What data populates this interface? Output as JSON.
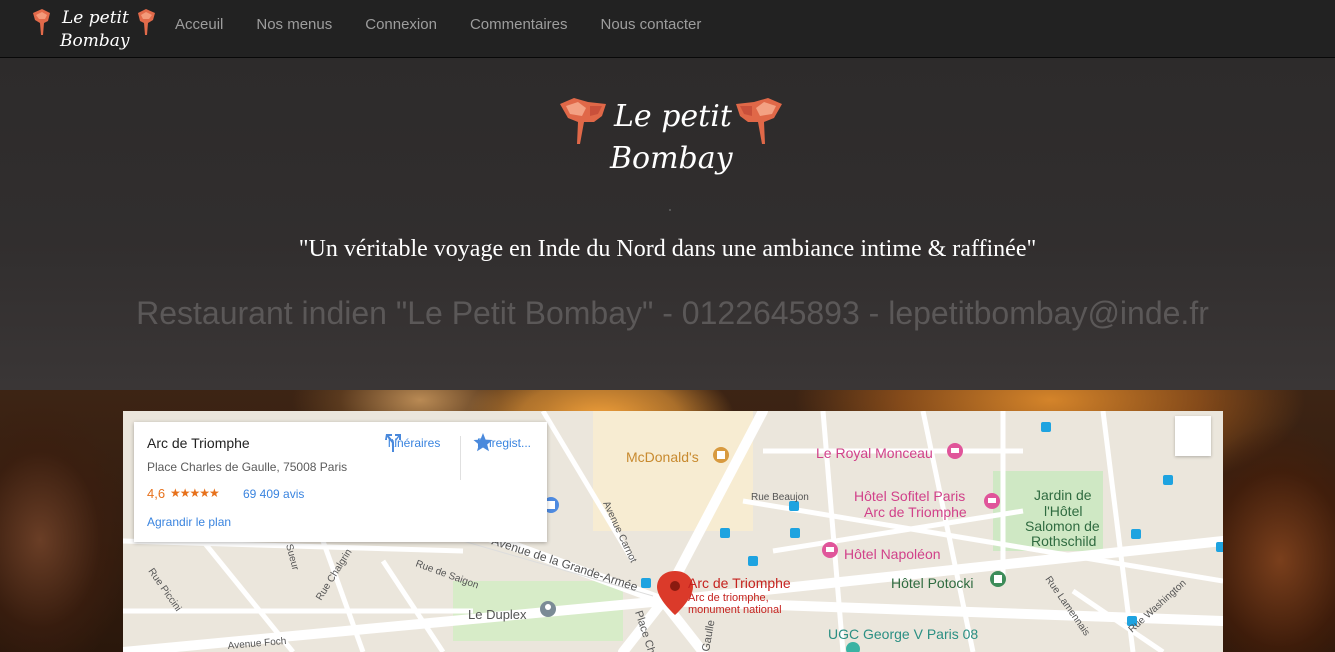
{
  "nav": {
    "logo_text_line1": "Le petit",
    "logo_text_line2": "Bombay",
    "links": [
      "Acceuil",
      "Nos menus",
      "Connexion",
      "Commentaires",
      "Nous contacter"
    ]
  },
  "header": {
    "logo_text_line1": "Le petit",
    "logo_text_line2": "Bombay",
    "tagline": "\"Un véritable voyage en Inde du Nord dans une ambiance intime & raffinée\"",
    "contact": "Restaurant indien \"Le Petit Bombay\" - 0122645893 - lepetitbombay@inde.fr"
  },
  "map": {
    "place_name": "Arc de Triomphe",
    "address": "Place Charles de Gaulle, 75008 Paris",
    "rating": "4,6",
    "stars": "★★★★★",
    "reviews": "69 409 avis",
    "directions_label": "Itinéraires",
    "save_label": "Enregist...",
    "enlarge_label": "Agrandir le plan",
    "marker_title": "Arc de Triomphe",
    "marker_sub1": "Arc de triomphe,",
    "marker_sub2": "monument national",
    "labels": {
      "mcdonalds": "McDonald's",
      "royal_monceau": "Le Royal Monceau",
      "sofitel_1": "Hôtel Sofitel Paris",
      "sofitel_2": "Arc de Triomphe",
      "jardin_1": "Jardin de",
      "jardin_2": "l'Hôtel",
      "jardin_3": "Salomon de",
      "jardin_4": "Rothschild",
      "napoleon": "Hôtel Napoléon",
      "potocki": "Hôtel Potocki",
      "ugc": "UGC George V Paris 08",
      "duplex": "Le Duplex",
      "rue_beaujon": "Rue Beaujon",
      "avenue_carnot": "Avenue Carnot",
      "grande_armee": "Avenue de la Grande-Armée",
      "rue_saigon": "Rue de Saigon",
      "rue_chalgrin": "Rue Chalgrin",
      "rue_piccini": "Rue Piccini",
      "rue_suelur": "Sueur",
      "avenue_foch": "Avenue Foch",
      "rue_lamennais": "Rue Lamennais",
      "rue_washington": "Rue Washington",
      "place_charles": "Place Charl",
      "gaulle": "Gaulle"
    }
  },
  "colors": {
    "nav_bg": "#222222",
    "nav_link": "#9d9d9d",
    "header_bg": "#2f2c2c",
    "tagline": "#ffffff",
    "contact": "#5b5858",
    "map_link": "#3a84df",
    "rating": "#e7711b",
    "poi_pink": "#e0559a",
    "poi_orange": "#d89a3f",
    "poi_green": "#3d8c59",
    "marker_red": "#db3a2a"
  }
}
